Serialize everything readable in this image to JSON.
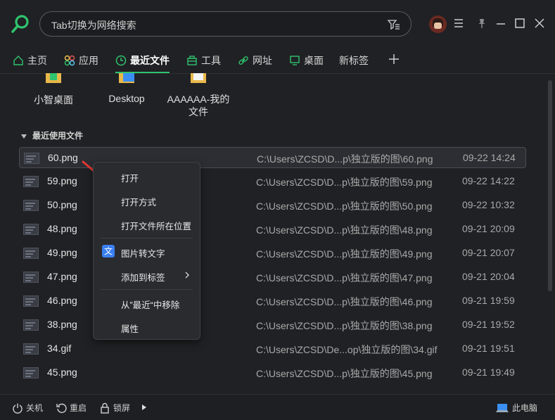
{
  "search": {
    "text": "Tab切换为网络搜索"
  },
  "tabs": [
    {
      "label": "主页"
    },
    {
      "label": "应用"
    },
    {
      "label": "最近文件"
    },
    {
      "label": "工具"
    },
    {
      "label": "网址"
    },
    {
      "label": "桌面"
    },
    {
      "label": "新标签"
    }
  ],
  "folders": [
    {
      "label": "小智桌面"
    },
    {
      "label": "Desktop"
    },
    {
      "label": "AAAAAA-我的文件"
    }
  ],
  "section_title": "最近使用文件",
  "files": [
    {
      "name": "60.png",
      "path": "C:\\Users\\ZCSD\\D...p\\独立版的图\\60.png",
      "date": "09-22 14:24"
    },
    {
      "name": "59.png",
      "path": "C:\\Users\\ZCSD\\D...p\\独立版的图\\59.png",
      "date": "09-22 14:22"
    },
    {
      "name": "50.png",
      "path": "C:\\Users\\ZCSD\\D...p\\独立版的图\\50.png",
      "date": "09-22 10:32"
    },
    {
      "name": "48.png",
      "path": "C:\\Users\\ZCSD\\D...p\\独立版的图\\48.png",
      "date": "09-21 20:09"
    },
    {
      "name": "49.png",
      "path": "C:\\Users\\ZCSD\\D...p\\独立版的图\\49.png",
      "date": "09-21 20:07"
    },
    {
      "name": "47.png",
      "path": "C:\\Users\\ZCSD\\D...p\\独立版的图\\47.png",
      "date": "09-21 20:04"
    },
    {
      "name": "46.png",
      "path": "C:\\Users\\ZCSD\\D...p\\独立版的图\\46.png",
      "date": "09-21 19:59"
    },
    {
      "name": "38.png",
      "path": "C:\\Users\\ZCSD\\D...p\\独立版的图\\38.png",
      "date": "09-21 19:52"
    },
    {
      "name": "34.gif",
      "path": "C:\\Users\\ZCSD\\De...op\\独立版的图\\34.gif",
      "date": "09-21 19:51"
    },
    {
      "name": "45.png",
      "path": "C:\\Users\\ZCSD\\D...p\\独立版的图\\45.png",
      "date": "09-21 19:49"
    }
  ],
  "context_menu": {
    "open": "打开",
    "open_with": "打开方式",
    "open_location": "打开文件所在位置",
    "ocr": "图片转文字",
    "ocr_icon": "文",
    "add_tag": "添加到标签",
    "remove_recent": "从”最近“中移除",
    "properties": "属性"
  },
  "bottom": {
    "shutdown": "关机",
    "restart": "重启",
    "lock": "锁屏",
    "this_pc": "此电脑"
  },
  "colors": {
    "accent": "#2fc46e",
    "menu_icon": "#3b7ff2",
    "annotation_arrow": "#e53935"
  }
}
